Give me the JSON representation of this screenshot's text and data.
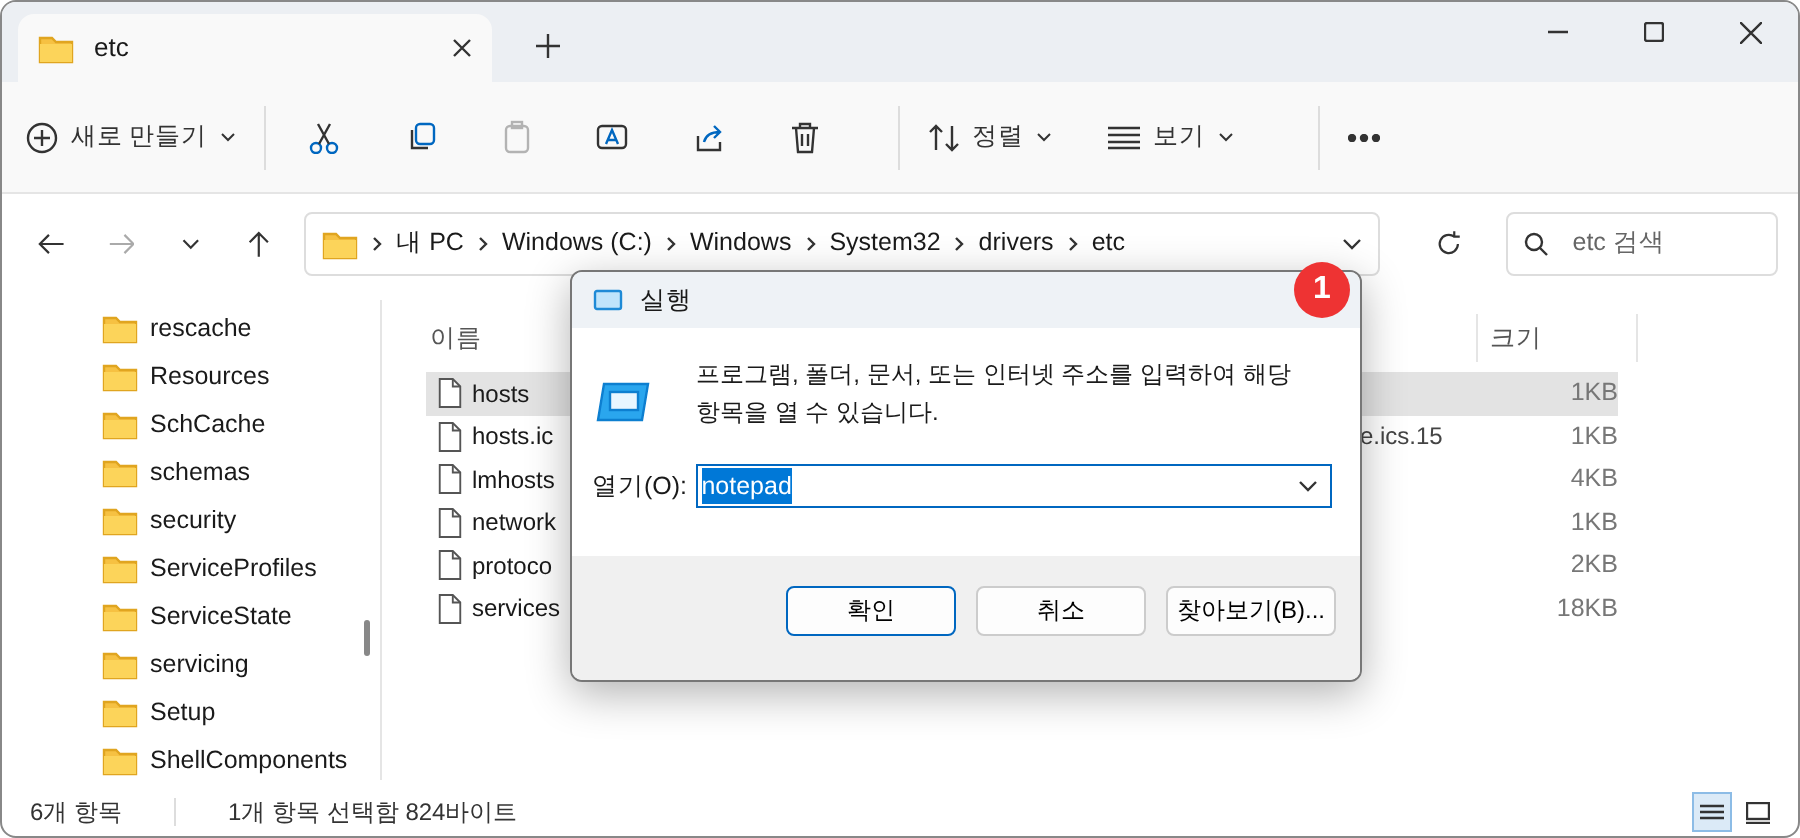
{
  "tabs": [
    {
      "label": "etc",
      "selected": true
    }
  ],
  "toolbar": {
    "new_label": "새로 만들기",
    "items": [
      {
        "kind": "cut",
        "disabled": false
      },
      {
        "kind": "copy",
        "disabled": false
      },
      {
        "kind": "paste",
        "disabled": true
      },
      {
        "kind": "rename",
        "disabled": false
      },
      {
        "kind": "share",
        "disabled": false
      },
      {
        "kind": "delete",
        "disabled": false
      }
    ],
    "sort_label": "정렬",
    "view_label": "보기"
  },
  "address": {
    "crumbs": [
      "내 PC",
      "Windows (C:)",
      "Windows",
      "System32",
      "drivers",
      "etc"
    ]
  },
  "search": {
    "placeholder": "etc 검색"
  },
  "nav_items": [
    "rescache",
    "Resources",
    "SchCache",
    "schemas",
    "security",
    "ServiceProfiles",
    "ServiceState",
    "servicing",
    "Setup",
    "ShellComponents"
  ],
  "file_list": {
    "columns": [
      "이름",
      "크기"
    ],
    "rows": [
      {
        "name": "hosts",
        "size": "1KB",
        "selected": true
      },
      {
        "name": "hosts.ic",
        "tail": "e.ics.15",
        "size": "1KB",
        "selected": false
      },
      {
        "name": "lmhosts",
        "size": "4KB",
        "selected": false
      },
      {
        "name": "network",
        "size": "1KB",
        "selected": false
      },
      {
        "name": "protoco",
        "size": "2KB",
        "selected": false
      },
      {
        "name": "services",
        "size": "18KB",
        "selected": false
      }
    ]
  },
  "status_bar": {
    "count": "6개 항목",
    "selection": "1개 항목 선택함 824바이트"
  },
  "view_buttons": [
    {
      "kind": "details",
      "selected": true
    },
    {
      "kind": "tiles",
      "selected": false
    }
  ],
  "dialog": {
    "title": "실행",
    "message": "프로그램, 폴더, 문서, 또는 인터넷 주소를 입력하여 해당 항목을 열 수 있습니다.",
    "open_label": "열기(O):",
    "value": "notepad",
    "buttons": [
      {
        "label": "확인",
        "default": true
      },
      {
        "label": "취소",
        "default": false
      },
      {
        "label": "찾아보기(B)...",
        "default": false
      }
    ]
  },
  "callout": "1"
}
